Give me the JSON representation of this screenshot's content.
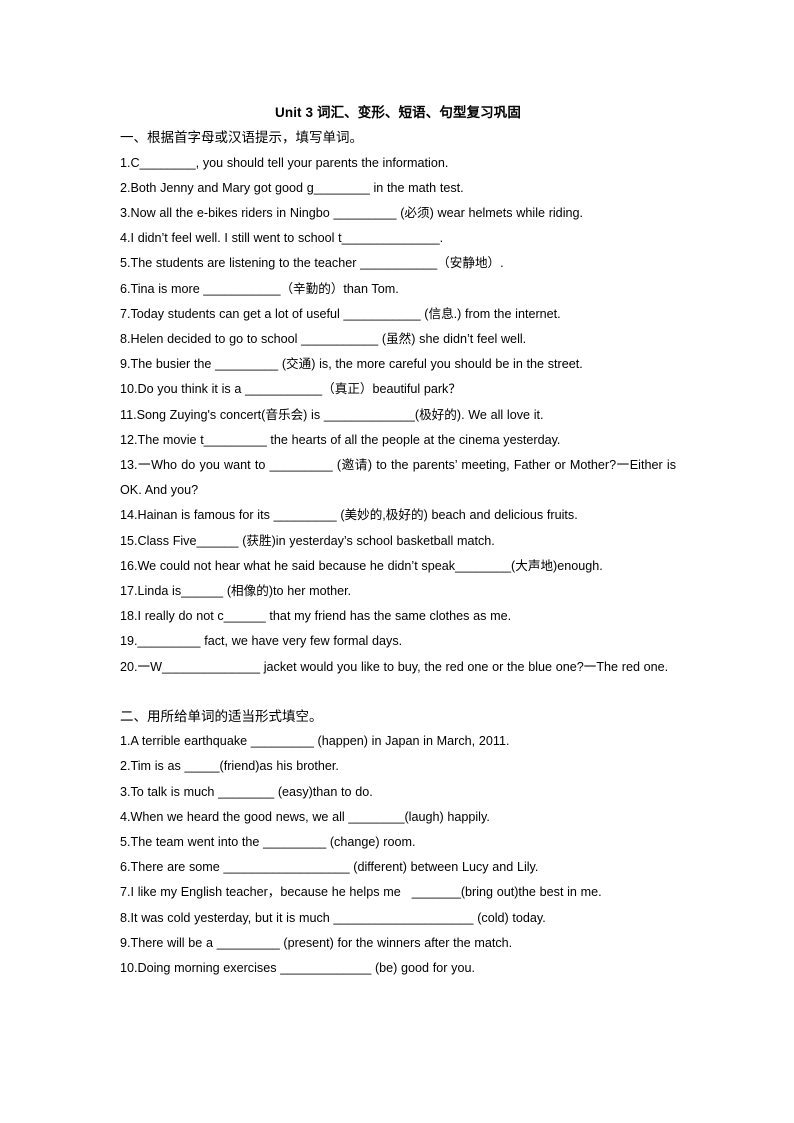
{
  "document": {
    "title": "Unit 3  词汇、变形、短语、句型复习巩固"
  },
  "section_one": {
    "heading": "一、根据首字母或汉语提示，填写单词。",
    "items": [
      "1.C________, you should tell your parents the information.",
      "2.Both Jenny and Mary got good g________ in the math test.",
      "3.Now all the e-bikes riders in Ningbo _________ (必须) wear helmets while riding.",
      "4.I didn’t feel well. I still went to school t______________.",
      "5.The students are listening to the teacher ___________（安静地）.",
      "6.Tina is more ___________（辛勤的）than Tom.",
      "7.Today students can get a lot of useful ___________ (信息.) from the internet.",
      "8.Helen decided to go to school ___________ (虽然) she didn’t feel well.",
      "9.The busier the _________ (交通) is, the more careful you should be in the street.",
      "10.Do you think it is a ___________（真正）beautiful park？",
      "11.Song Zuying's concert(音乐会) is _____________(极好的). We all love it.",
      "12.The movie t_________ the hearts of all the people at the cinema yesterday.",
      "13.一Who do you want to _________ (邀请) to the parents’ meeting, Father or Mother?一Either is OK. And you?",
      "14.Hainan is famous for its _________ (美妙的,极好的) beach and delicious fruits.",
      "15.Class Five______ (获胜)in yesterday’s school basketball match.",
      "16.We could not hear what he said because he didn’t speak________(大声地)enough.",
      "17.Linda is______ (相像的)to her mother.",
      "18.I really do not c______ that my friend has the same clothes as me.",
      "19._________ fact, we have very few formal days.",
      "20.一W______________ jacket would you like to buy, the red one or the blue one?一The red one."
    ],
    "justified_indexes": [
      12,
      15,
      19
    ]
  },
  "section_two": {
    "heading": "二、用所给单词的适当形式填空。",
    "items": [
      "1.A terrible earthquake _________ (happen) in Japan in March, 2011.",
      "2.Tim is as _____(friend)as his brother.",
      "3.To talk is much ________ (easy)than to do.",
      "4.When we heard the good news, we all ________(laugh) happily.",
      "5.The team went into the _________ (change) room.",
      "6.There are some __________________ (different) between Lucy and Lily.",
      "7.I like my English teacher，because he helps me   _______(bring out)the best in me.",
      "8.It was cold yesterday, but it is much ____________________ (cold) today.",
      "9.There will be a _________ (present) for the winners after the match.",
      "10.Doing morning exercises _____________ (be) good for you."
    ]
  }
}
